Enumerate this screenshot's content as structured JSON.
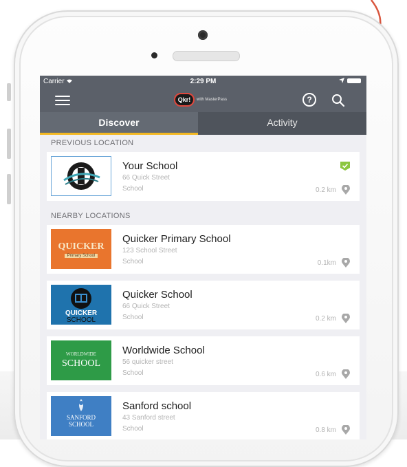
{
  "colors": {
    "header_bg": "#5b6069",
    "tab_underline": "#f3b822",
    "check": "#8cc63f",
    "annotation_arrow": "#d9573f"
  },
  "status_bar": {
    "carrier": "Carrier",
    "time": "2:29 PM"
  },
  "header": {
    "logo_text": "Qkr!",
    "logo_sub": "with MasterPass",
    "icons": [
      "hamburger-menu-icon",
      "help-icon",
      "search-icon"
    ]
  },
  "tabs": [
    {
      "label": "Discover",
      "active": true
    },
    {
      "label": "Activity",
      "active": false
    }
  ],
  "previous_section": {
    "title": "PREVIOUS LOCATION",
    "items": [
      {
        "name": "Your School",
        "address": "66 Quick Street",
        "type": "School",
        "distance": "0.2 km",
        "selected": true
      }
    ]
  },
  "nearby_section": {
    "title": "NEARBY LOCATIONS",
    "items": [
      {
        "name": "Quicker Primary School",
        "address": "123 School Street",
        "type": "School",
        "distance": "0.1km",
        "thumb_text": "QUICKER",
        "thumb_sub": "Primary School"
      },
      {
        "name": "Quicker School",
        "address": "66 Quick Street",
        "type": "School",
        "distance": "0.2 km",
        "thumb_text": "QUICKER",
        "thumb_sub": "SCHOOL"
      },
      {
        "name": "Worldwide School",
        "address": "56 quicker street",
        "type": "School",
        "distance": "0.6 km",
        "thumb_text": "WORLDWIDE",
        "thumb_sub": "SCHOOL"
      },
      {
        "name": "Sanford school",
        "address": "43 Sanford street",
        "type": "School",
        "distance": "0.8 km",
        "thumb_text": "SANFORD",
        "thumb_sub": "SCHOOL"
      }
    ]
  }
}
